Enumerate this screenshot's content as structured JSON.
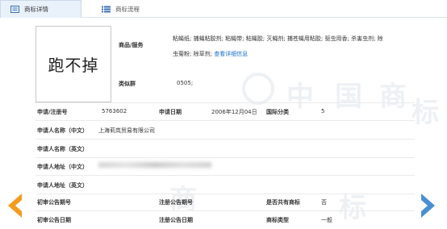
{
  "tabs": [
    {
      "label": "商标详情",
      "icon": "document-list-icon"
    },
    {
      "label": "商标流程",
      "icon": "flow-list-icon"
    }
  ],
  "trademark": {
    "image_text": "跑不掉",
    "goods_label": "商品/服务",
    "goods_line1": "粘蝇纸; 捕蝇粘胶剂; 粘蝇带; 粘蝇胶; 灭蝇剂; 捕苍蝇用粘胶; 驱虫用香; 杀害虫剂; 除",
    "goods_line2": "虫菊粉; 除草剂;",
    "goods_link": "查看详细信息",
    "similar_group_label": "类似群",
    "similar_group_value": "0505;"
  },
  "fields": {
    "reg_no_label": "申请/注册号",
    "reg_no_value": "5763602",
    "app_date_label": "申请日期",
    "app_date_value": "2006年12月04日",
    "intl_class_label": "国际分类",
    "intl_class_value": "5",
    "applicant_cn_label": "申请人名称（中文）",
    "applicant_cn_value": "上海莉岚贸易有限公司",
    "applicant_en_label": "申请人名称（英文）",
    "address_cn_label": "申请人地址（中文）",
    "address_en_label": "申请人地址（英文）",
    "prelim_no_label": "初审公告期号",
    "reg_pub_no_label": "注册公告期号",
    "shared_label": "是否共有商标",
    "shared_value": "否",
    "prelim_date_label": "初审公告日期",
    "reg_pub_date_label": "注册公告日期",
    "tm_type_label": "商标类型",
    "tm_type_value": "一般"
  },
  "colors": {
    "prev_arrow": "#f39c1f",
    "next_arrow": "#4a8fd4",
    "link": "#1a6fc9",
    "active_tab": "#e9f1fb"
  }
}
